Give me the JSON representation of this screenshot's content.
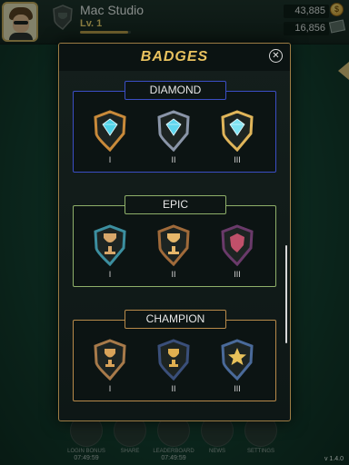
{
  "header": {
    "player_name": "Mac Studio",
    "level": "Lv. 1",
    "xp_progress": 0.95,
    "coins": "43,885",
    "cash": "16,856"
  },
  "modal": {
    "title": "BADGES",
    "close_icon": "close-circle-icon"
  },
  "sections": [
    {
      "name": "DIAMOND",
      "border_color": "#3b4ec4",
      "badges": [
        {
          "label": "I",
          "icon": "diamond-badge-bronze-icon"
        },
        {
          "label": "II",
          "icon": "diamond-badge-silver-icon"
        },
        {
          "label": "III",
          "icon": "diamond-badge-gold-icon"
        }
      ]
    },
    {
      "name": "EPIC",
      "border_color": "#8fb06a",
      "badges": [
        {
          "label": "I",
          "icon": "trophy-badge-teal-icon"
        },
        {
          "label": "II",
          "icon": "trophy-badge-bronze-icon"
        },
        {
          "label": "III",
          "icon": "shield-badge-purple-icon"
        }
      ]
    },
    {
      "name": "CHAMPION",
      "border_color": "#b88a4a",
      "badges": [
        {
          "label": "I",
          "icon": "cup-shield-bronze-icon"
        },
        {
          "label": "II",
          "icon": "cup-shield-gold-icon"
        },
        {
          "label": "III",
          "icon": "star-shield-blue-icon"
        }
      ]
    }
  ],
  "bottom_nav": [
    {
      "label": "LOGIN BONUS",
      "timer": "07:49:59",
      "icon": "calendar-icon"
    },
    {
      "label": "SHARE",
      "timer": "",
      "icon": "share-icon"
    },
    {
      "label": "LEADERBOARD",
      "timer": "07:49:59",
      "icon": "leaderboard-icon"
    },
    {
      "label": "NEWS",
      "timer": "",
      "icon": "news-icon"
    },
    {
      "label": "SETTINGS",
      "timer": "",
      "icon": "gear-icon"
    }
  ],
  "version": "v 1.4.0"
}
